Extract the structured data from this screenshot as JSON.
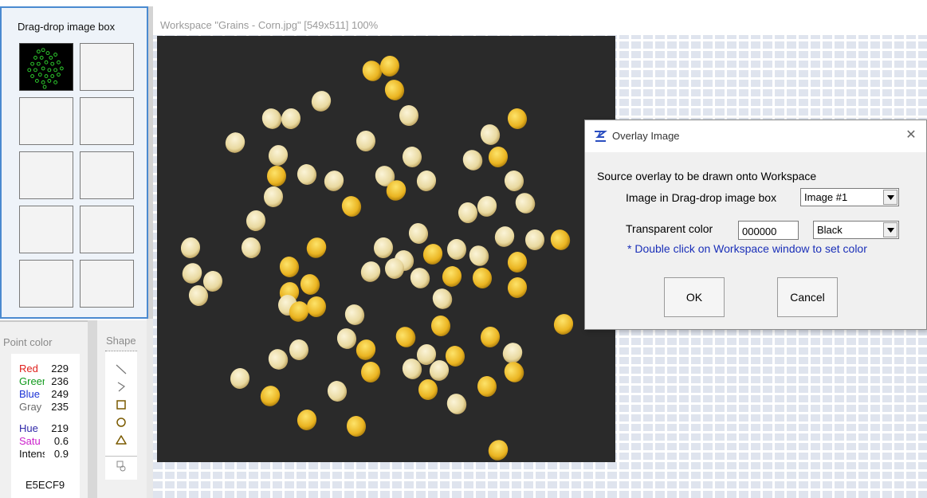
{
  "dragdrop": {
    "title": "Drag-drop image box"
  },
  "point_color": {
    "title": "Point color",
    "rows": [
      {
        "label": "Red",
        "value": "229",
        "color": "#e0201c"
      },
      {
        "label": "Green",
        "value": "236",
        "color": "#119a1d"
      },
      {
        "label": "Blue",
        "value": "249",
        "color": "#1c33d6"
      },
      {
        "label": "Gray",
        "value": "235",
        "color": "#6c6c6c"
      },
      {
        "label": "Hue",
        "value": "219",
        "color": "#2f28a8"
      },
      {
        "label": "Satu",
        "value": "0.6",
        "color": "#cc20cc"
      },
      {
        "label": "Intens",
        "value": "0.9",
        "color": "#111111"
      }
    ],
    "hex": "E5ECF9"
  },
  "shape": {
    "title": "Shape",
    "tools": [
      "line-icon",
      "polyline-icon",
      "rectangle-icon",
      "circle-icon",
      "polygon-icon",
      "fill-icon"
    ]
  },
  "workspace": {
    "title": "Workspace \"Grains - Corn.jpg\"  [549x511] 100%"
  },
  "dialog": {
    "title": "Overlay Image",
    "close": "✕",
    "heading": "Source overlay to be drawn onto Workspace",
    "image_label": "Image in Drag-drop image box",
    "image_value": "Image #1",
    "transparent_label": "Transparent color",
    "transparent_value": "000000",
    "color_value": "Black",
    "hint": "* Double click on Workspace window to set color",
    "ok": "OK",
    "cancel": "Cancel"
  },
  "colors": {
    "accent": "#4a8ad0",
    "hint_blue": "#1a2fb8"
  }
}
